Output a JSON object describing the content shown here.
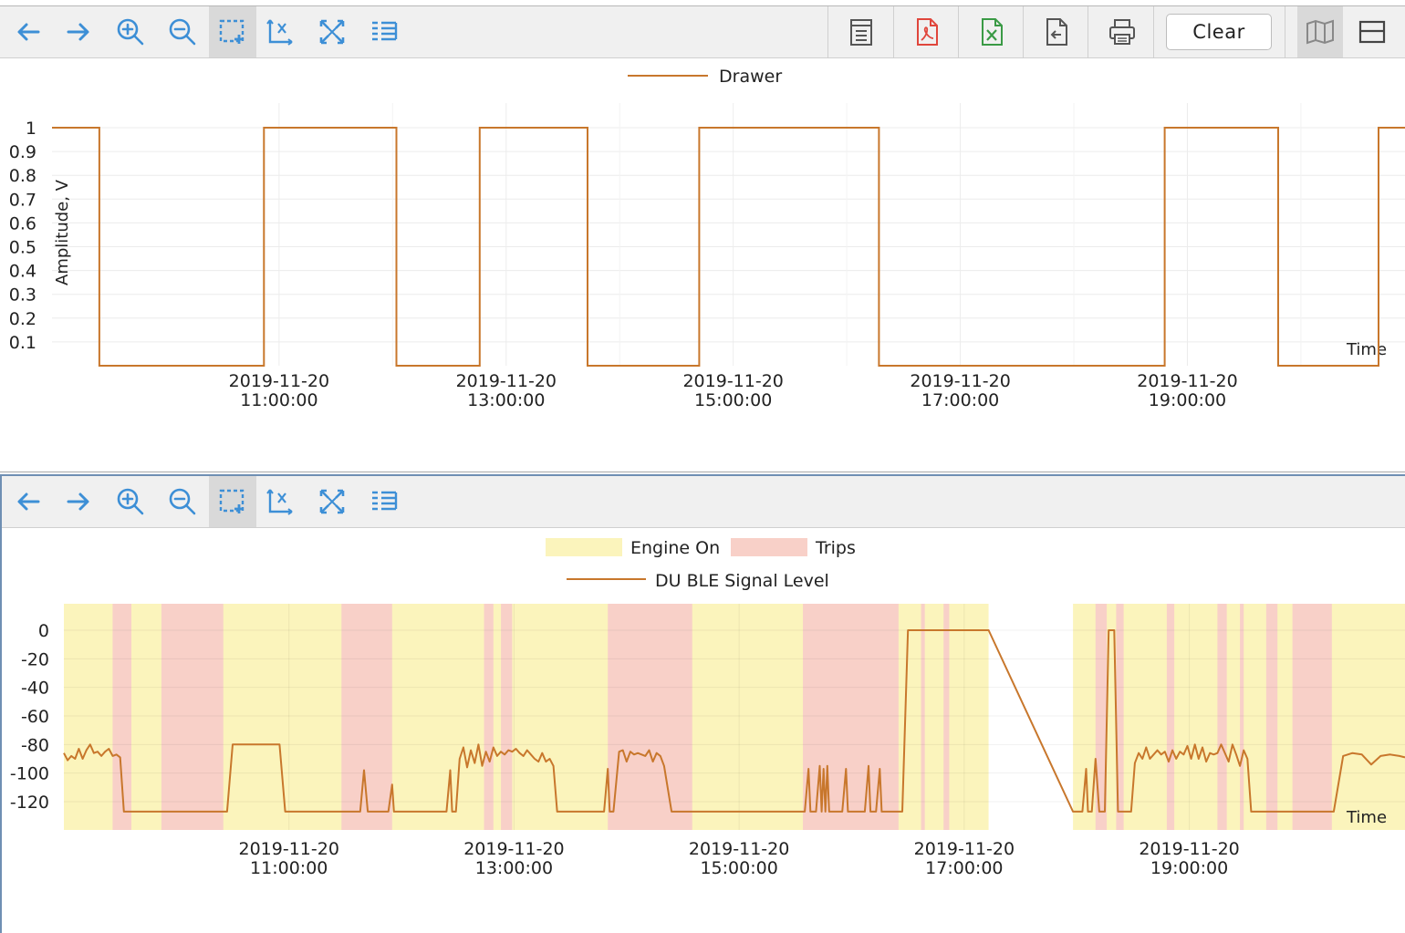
{
  "toolbar": {
    "clear_label": "Clear",
    "icons": [
      "arrow-left-icon",
      "arrow-right-icon",
      "zoom-in-icon",
      "zoom-out-icon",
      "select-region-icon",
      "reset-axis-icon",
      "fit-all-icon",
      "legend-list-icon"
    ],
    "export_icons": [
      "report-icon",
      "pdf-icon",
      "excel-icon",
      "export-file-icon",
      "print-icon"
    ],
    "view_icons": [
      "map-icon",
      "layout-icon"
    ]
  },
  "colors": {
    "line": "#c8772c",
    "engine_on": "#fbf4bc",
    "trips": "#f8d0c8",
    "accent_blue": "#3d8fd6"
  },
  "chart_data": [
    {
      "type": "line",
      "title": "",
      "xlabel": "Time",
      "ylabel": "Amplitude, V",
      "legend": [
        {
          "name": "Drawer",
          "kind": "line"
        }
      ],
      "legend_position": "top-center",
      "grid": true,
      "ylim": [
        0,
        1
      ],
      "xlim": [
        "2019-11-20 09:00:00",
        "2019-11-20 20:55:00"
      ],
      "yticks": [
        "1",
        "0.9",
        "0.8",
        "0.7",
        "0.6",
        "0.5",
        "0.4",
        "0.3",
        "0.2",
        "0.1"
      ],
      "xticks": [
        {
          "date": "2019-11-20",
          "time": "11:00:00"
        },
        {
          "date": "2019-11-20",
          "time": "13:00:00"
        },
        {
          "date": "2019-11-20",
          "time": "15:00:00"
        },
        {
          "date": "2019-11-20",
          "time": "17:00:00"
        },
        {
          "date": "2019-11-20",
          "time": "19:00:00"
        }
      ],
      "series": [
        {
          "name": "Drawer",
          "step": true,
          "points": [
            [
              "09:00",
              1
            ],
            [
              "09:25",
              1
            ],
            [
              "09:25",
              0
            ],
            [
              "10:52",
              0
            ],
            [
              "10:52",
              1
            ],
            [
              "12:02",
              1
            ],
            [
              "12:02",
              0
            ],
            [
              "12:46",
              0
            ],
            [
              "12:46",
              1
            ],
            [
              "13:43",
              1
            ],
            [
              "13:43",
              0
            ],
            [
              "14:42",
              0
            ],
            [
              "14:42",
              1
            ],
            [
              "16:17",
              1
            ],
            [
              "16:17",
              0
            ],
            [
              "18:48",
              0
            ],
            [
              "18:48",
              1
            ],
            [
              "19:48",
              1
            ],
            [
              "19:48",
              0
            ],
            [
              "20:41",
              0
            ],
            [
              "20:41",
              1
            ],
            [
              "20:55",
              1
            ]
          ]
        }
      ]
    },
    {
      "type": "line",
      "title": "",
      "xlabel": "Time",
      "ylabel": "",
      "legend": [
        {
          "name": "Engine On",
          "kind": "band"
        },
        {
          "name": "Trips",
          "kind": "band"
        },
        {
          "name": "DU BLE Signal Level",
          "kind": "line"
        }
      ],
      "legend_position": "top-center",
      "grid": true,
      "ylim": [
        -140,
        20
      ],
      "xlim": [
        "2019-11-20 09:00:00",
        "2019-11-20 20:55:00"
      ],
      "yticks": [
        "0",
        "-20",
        "-40",
        "-60",
        "-80",
        "-100",
        "-120"
      ],
      "xticks": [
        {
          "date": "2019-11-20",
          "time": "11:00:00"
        },
        {
          "date": "2019-11-20",
          "time": "13:00:00"
        },
        {
          "date": "2019-11-20",
          "time": "15:00:00"
        },
        {
          "date": "2019-11-20",
          "time": "17:00:00"
        },
        {
          "date": "2019-11-20",
          "time": "19:00:00"
        }
      ],
      "bands": {
        "engine_on": [
          [
            "09:00",
            "17:13"
          ],
          [
            "17:58",
            "20:55"
          ]
        ],
        "trips": [
          [
            "09:26",
            "09:36"
          ],
          [
            "09:52",
            "10:25"
          ],
          [
            "11:28",
            "11:55"
          ],
          [
            "12:44",
            "12:49"
          ],
          [
            "12:53",
            "12:59"
          ],
          [
            "13:50",
            "14:35"
          ],
          [
            "15:34",
            "16:25"
          ],
          [
            "16:37",
            "16:39"
          ],
          [
            "16:49",
            "16:52"
          ],
          [
            "18:10",
            "18:16"
          ],
          [
            "18:21",
            "18:25"
          ],
          [
            "18:48",
            "18:52"
          ],
          [
            "19:15",
            "19:20"
          ],
          [
            "19:27",
            "19:29"
          ],
          [
            "19:41",
            "19:47"
          ],
          [
            "19:55",
            "20:16"
          ]
        ]
      },
      "series": [
        {
          "name": "DU BLE Signal Level",
          "points": [
            [
              "09:00",
              -86
            ],
            [
              "09:02",
              -91
            ],
            [
              "09:04",
              -88
            ],
            [
              "09:06",
              -90
            ],
            [
              "09:08",
              -83
            ],
            [
              "09:10",
              -90
            ],
            [
              "09:12",
              -84
            ],
            [
              "09:14",
              -80
            ],
            [
              "09:16",
              -86
            ],
            [
              "09:18",
              -85
            ],
            [
              "09:20",
              -88
            ],
            [
              "09:22",
              -85
            ],
            [
              "09:24",
              -83
            ],
            [
              "09:26",
              -88
            ],
            [
              "09:28",
              -87
            ],
            [
              "09:30",
              -89
            ],
            [
              "09:32",
              -127
            ],
            [
              "10:27",
              -127
            ],
            [
              "10:30",
              -80
            ],
            [
              "10:55",
              -80
            ],
            [
              "10:58",
              -127
            ],
            [
              "11:38",
              -127
            ],
            [
              "11:40",
              -98
            ],
            [
              "11:42",
              -127
            ],
            [
              "11:53",
              -127
            ],
            [
              "11:55",
              -108
            ],
            [
              "11:56",
              -127
            ],
            [
              "12:24",
              -127
            ],
            [
              "12:26",
              -98
            ],
            [
              "12:27",
              -127
            ],
            [
              "12:29",
              -127
            ],
            [
              "12:31",
              -90
            ],
            [
              "12:33",
              -82
            ],
            [
              "12:35",
              -96
            ],
            [
              "12:37",
              -84
            ],
            [
              "12:39",
              -93
            ],
            [
              "12:41",
              -80
            ],
            [
              "12:43",
              -95
            ],
            [
              "12:45",
              -85
            ],
            [
              "12:47",
              -92
            ],
            [
              "12:49",
              -82
            ],
            [
              "12:51",
              -88
            ],
            [
              "12:53",
              -85
            ],
            [
              "12:55",
              -87
            ],
            [
              "12:57",
              -84
            ],
            [
              "12:59",
              -85
            ],
            [
              "13:01",
              -83
            ],
            [
              "13:03",
              -86
            ],
            [
              "13:05",
              -88
            ],
            [
              "13:07",
              -84
            ],
            [
              "13:09",
              -87
            ],
            [
              "13:11",
              -90
            ],
            [
              "13:13",
              -92
            ],
            [
              "13:15",
              -86
            ],
            [
              "13:17",
              -92
            ],
            [
              "13:19",
              -90
            ],
            [
              "13:21",
              -95
            ],
            [
              "13:23",
              -127
            ],
            [
              "13:48",
              -127
            ],
            [
              "13:50",
              -97
            ],
            [
              "13:51",
              -127
            ],
            [
              "13:53",
              -127
            ],
            [
              "13:56",
              -85
            ],
            [
              "13:58",
              -84
            ],
            [
              "14:00",
              -92
            ],
            [
              "14:02",
              -85
            ],
            [
              "14:04",
              -87
            ],
            [
              "14:06",
              -86
            ],
            [
              "14:08",
              -87
            ],
            [
              "14:10",
              -88
            ],
            [
              "14:12",
              -84
            ],
            [
              "14:14",
              -92
            ],
            [
              "14:16",
              -86
            ],
            [
              "14:18",
              -88
            ],
            [
              "14:20",
              -95
            ],
            [
              "14:24",
              -127
            ],
            [
              "15:35",
              -127
            ],
            [
              "15:37",
              -97
            ],
            [
              "15:38",
              -127
            ],
            [
              "15:41",
              -127
            ],
            [
              "15:43",
              -95
            ],
            [
              "15:44",
              -127
            ],
            [
              "15:45",
              -97
            ],
            [
              "15:46",
              -127
            ],
            [
              "15:47",
              -95
            ],
            [
              "15:48",
              -127
            ],
            [
              "15:55",
              -127
            ],
            [
              "15:57",
              -97
            ],
            [
              "15:58",
              -127
            ],
            [
              "16:07",
              -127
            ],
            [
              "16:09",
              -95
            ],
            [
              "16:10",
              -127
            ],
            [
              "16:13",
              -127
            ],
            [
              "16:15",
              -97
            ],
            [
              "16:16",
              -127
            ],
            [
              "16:27",
              -127
            ],
            [
              "16:30",
              0
            ],
            [
              "17:13",
              0
            ],
            [
              "17:58",
              -127
            ],
            [
              "18:03",
              -127
            ],
            [
              "18:05",
              -97
            ],
            [
              "18:06",
              -127
            ],
            [
              "18:08",
              -127
            ],
            [
              "18:10",
              -90
            ],
            [
              "18:12",
              -127
            ],
            [
              "18:15",
              -127
            ],
            [
              "18:17",
              0
            ],
            [
              "18:20",
              0
            ],
            [
              "18:22",
              -127
            ],
            [
              "18:29",
              -127
            ],
            [
              "18:31",
              -93
            ],
            [
              "18:33",
              -86
            ],
            [
              "18:35",
              -90
            ],
            [
              "18:37",
              -82
            ],
            [
              "18:39",
              -90
            ],
            [
              "18:41",
              -87
            ],
            [
              "18:43",
              -84
            ],
            [
              "18:45",
              -87
            ],
            [
              "18:47",
              -85
            ],
            [
              "18:49",
              -92
            ],
            [
              "18:51",
              -84
            ],
            [
              "18:53",
              -90
            ],
            [
              "18:55",
              -85
            ],
            [
              "18:57",
              -87
            ],
            [
              "18:59",
              -81
            ],
            [
              "19:01",
              -90
            ],
            [
              "19:03",
              -80
            ],
            [
              "19:05",
              -90
            ],
            [
              "19:07",
              -82
            ],
            [
              "19:09",
              -92
            ],
            [
              "19:11",
              -86
            ],
            [
              "19:13",
              -87
            ],
            [
              "19:15",
              -86
            ],
            [
              "19:17",
              -80
            ],
            [
              "19:19",
              -86
            ],
            [
              "19:21",
              -92
            ],
            [
              "19:23",
              -80
            ],
            [
              "19:25",
              -87
            ],
            [
              "19:27",
              -95
            ],
            [
              "19:29",
              -84
            ],
            [
              "19:31",
              -90
            ],
            [
              "19:33",
              -127
            ],
            [
              "20:17",
              -127
            ],
            [
              "20:22",
              -88
            ],
            [
              "20:27",
              -86
            ],
            [
              "20:32",
              -87
            ],
            [
              "20:37",
              -94
            ],
            [
              "20:42",
              -88
            ],
            [
              "20:47",
              -87
            ],
            [
              "20:52",
              -88
            ],
            [
              "20:55",
              -89
            ]
          ]
        }
      ]
    }
  ]
}
